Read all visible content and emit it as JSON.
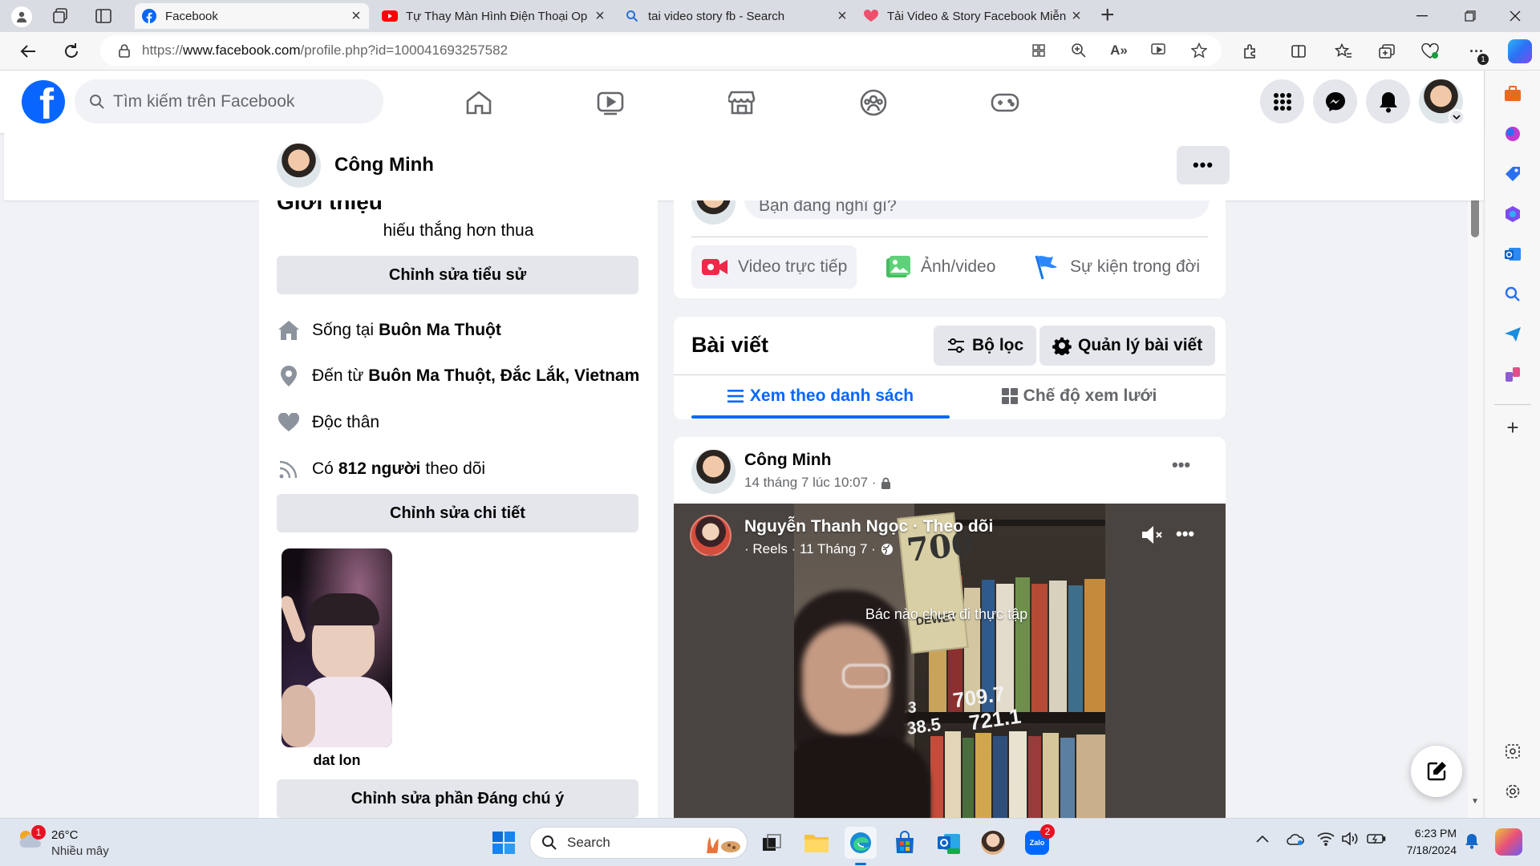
{
  "browser": {
    "tabs": [
      {
        "title": "Facebook",
        "active": true
      },
      {
        "title": "Tự Thay Màn Hình Điện Thoại Op",
        "active": false
      },
      {
        "title": "tai video story fb - Search",
        "active": false
      },
      {
        "title": "Tải Video & Story Facebook Miễn",
        "active": false
      }
    ],
    "url_prefix": "https://",
    "url_domain": "www.facebook.com",
    "url_path": "/profile.php?id=100041693257582",
    "new_tab": "+",
    "extension_badge": "1"
  },
  "facebook": {
    "logo_letter": "f",
    "search_placeholder": "Tìm kiếm trên Facebook",
    "brand_color": "#0866ff"
  },
  "profile": {
    "name": "Công Minh",
    "more": "•••"
  },
  "intro": {
    "heading": "Giới thiệu",
    "bio": "hiếu thắng hơn thua",
    "edit_bio": "Chỉnh sửa tiểu sử",
    "lives_prefix": "Sống tại",
    "lives_city": "Buôn Ma Thuột",
    "from_prefix": "Đến từ",
    "from_city": "Buôn Ma Thuột, Đắc Lắk, Vietnam",
    "relationship": "Độc thân",
    "followers_prefix": "Có",
    "followers_count": "812 người",
    "followers_suffix": "theo dõi",
    "edit_details": "Chỉnh sửa chi tiết",
    "highlight_caption": "dat lon",
    "edit_featured": "Chỉnh sửa phần Đáng chú ý"
  },
  "composer": {
    "placeholder": "Bạn đang nghĩ gì?",
    "live_video": "Video trực tiếp",
    "photo_video": "Ảnh/video",
    "life_event": "Sự kiện trong đời"
  },
  "posts": {
    "title": "Bài viết",
    "filter": "Bộ lọc",
    "manage": "Quản lý bài viết",
    "list_view": "Xem theo danh sách",
    "grid_view": "Chế độ xem lưới"
  },
  "post": {
    "author": "Công Minh",
    "time": "14 tháng 7 lúc 10:07 ·",
    "more": "•••",
    "reel_author": "Nguyễn Thanh Ngọc · Theo dõi",
    "reel_meta": "· Reels · 11 Tháng 7 ·",
    "reel_more": "•••",
    "video_caption": "Bác nào chưa đi thực tập",
    "shelf_label_1": "709.7",
    "shelf_label_2": "721.1",
    "shelf_label_3": "738.5",
    "shelf_label_4": ".3",
    "sign_700": "700",
    "sign_dewey": "DEWEY"
  },
  "taskbar": {
    "temperature": "26°C",
    "weather": "Nhiều mây",
    "weather_badge": "1",
    "search_label": "Search",
    "zalo_label": "Zalo",
    "zalo_badge": "2",
    "time": "6:23 PM",
    "date": "7/18/2024"
  }
}
